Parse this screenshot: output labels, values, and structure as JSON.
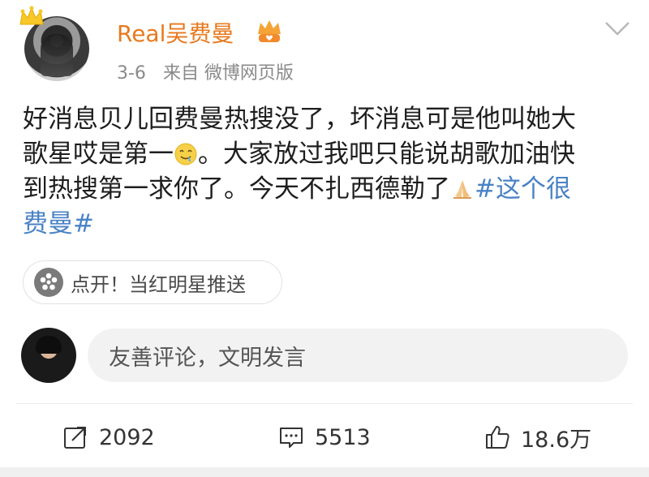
{
  "header": {
    "username": "Real吴费曼",
    "time": "3-6",
    "source": "来自 微博网页版"
  },
  "post": {
    "line1": "好消息贝儿回费曼热搜没了，坏消息可是他叫她大",
    "line2a": "歌星哎是第一",
    "line2b": "。大家放过我吧只能说胡歌加油快",
    "line3a": "到热搜第一求你了。今天不扎西德勒了",
    "hashtag1": "#这个很",
    "hashtag2": "费曼#"
  },
  "push": {
    "label": "点开！当红明星推送"
  },
  "comment_box": {
    "placeholder": "友善评论，文明发言"
  },
  "actions": {
    "repost_count": "2092",
    "comment_count": "5513",
    "like_count": "18.6万"
  },
  "colors": {
    "username": "#e8791e",
    "hashtag": "#4a82c6",
    "meta": "#8a8a8a"
  },
  "icons": {
    "crown_badge": "crown-icon",
    "vip": "vip-crown-icon",
    "more": "chevron-down-icon",
    "push": "flower-icon",
    "repost": "share-icon",
    "comment": "comment-icon",
    "like": "thumbs-up-icon"
  }
}
